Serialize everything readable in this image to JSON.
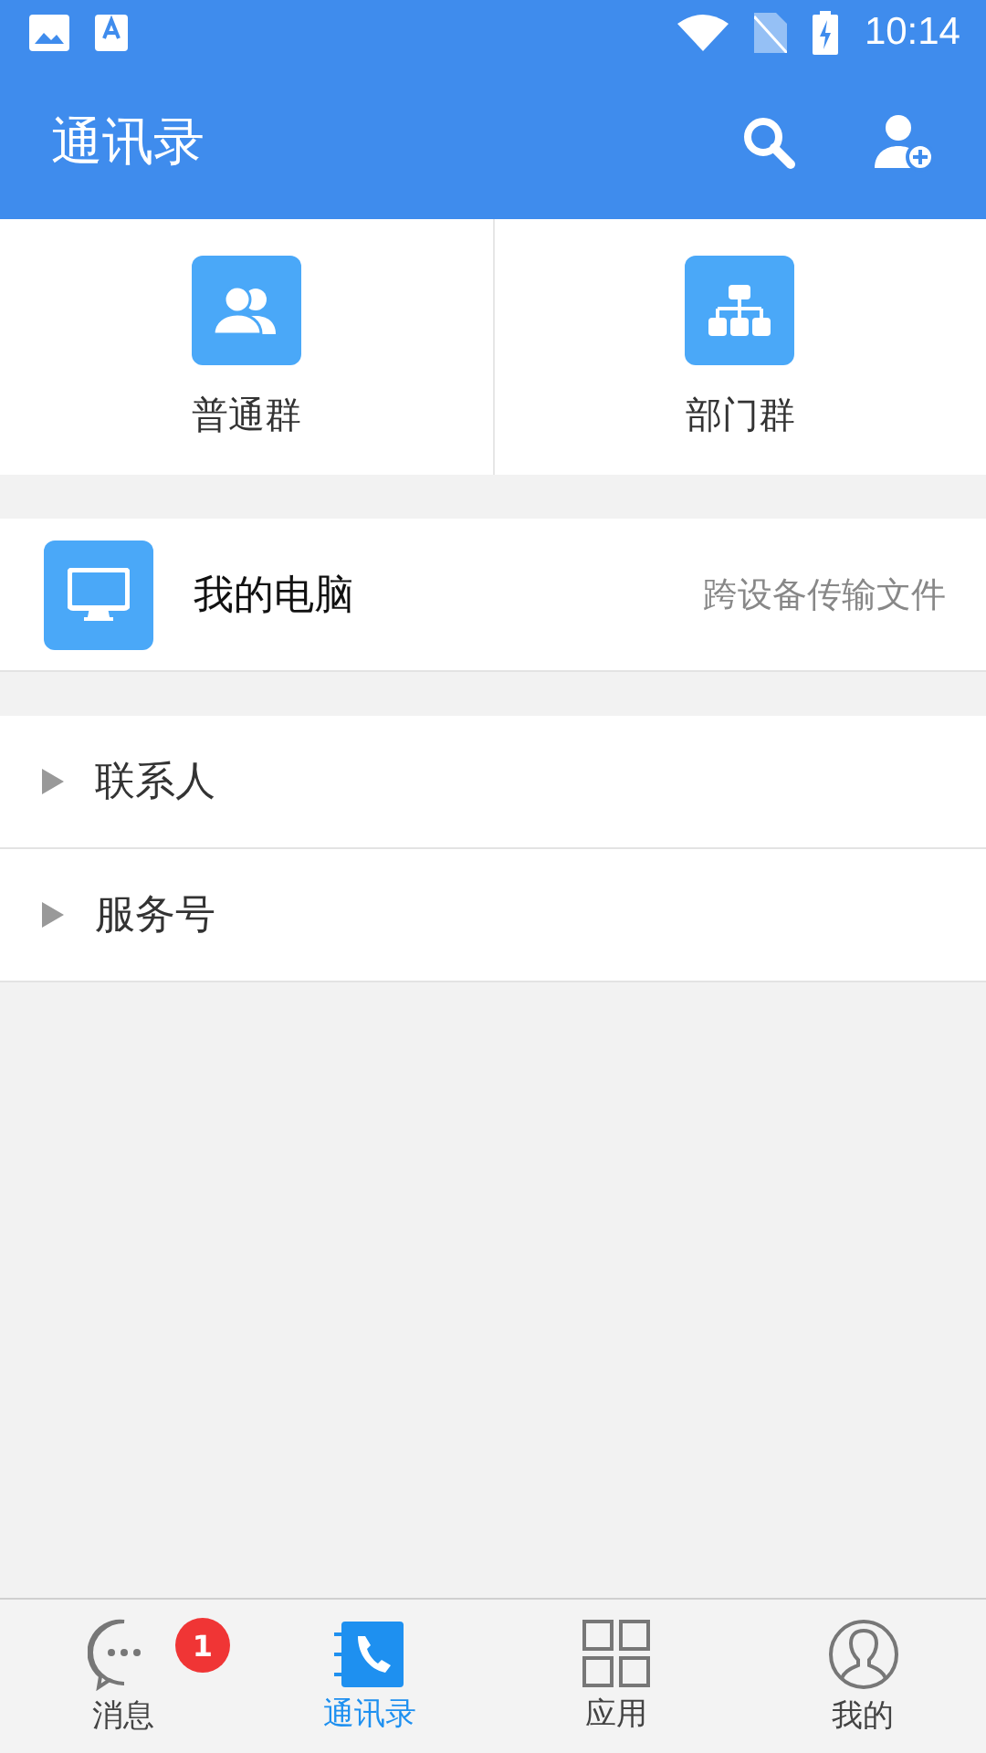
{
  "status_bar": {
    "time": "10:14"
  },
  "app_bar": {
    "title": "通讯录"
  },
  "groups": [
    {
      "kind": "normal",
      "label": "普通群"
    },
    {
      "kind": "department",
      "label": "部门群"
    }
  ],
  "my_computer": {
    "title": "我的电脑",
    "subtitle": "跨设备传输文件"
  },
  "sections": [
    {
      "label": "联系人",
      "expanded": false
    },
    {
      "label": "服务号",
      "expanded": false
    }
  ],
  "tabs": [
    {
      "kind": "messages",
      "label": "消息",
      "selected": false,
      "badge": "1"
    },
    {
      "kind": "contacts",
      "label": "通讯录",
      "selected": true
    },
    {
      "kind": "apps",
      "label": "应用",
      "selected": false
    },
    {
      "kind": "me",
      "label": "我的",
      "selected": false
    }
  ]
}
